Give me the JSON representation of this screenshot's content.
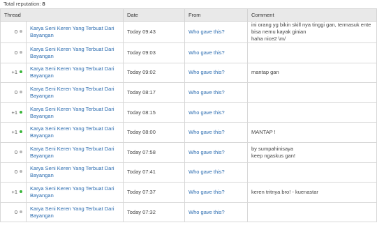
{
  "summary": {
    "label": "Total reputation:",
    "value": "8"
  },
  "columns": {
    "thread": "Thread",
    "date": "Date",
    "from": "From",
    "comment": "Comment"
  },
  "rows": [
    {
      "points": "0",
      "kind": "neutral",
      "thread": "Karya Seni Keren Yang Terbuat Dari Bayangan",
      "date": "Today 09:43",
      "from": "Who gave this?",
      "comment": "ini orang yg bikin skill nya tinggi gan, termasuk ente bisa nemu kayak ginian\nhaha nice2 \\m/"
    },
    {
      "points": "0",
      "kind": "neutral",
      "thread": "Karya Seni Keren Yang Terbuat Dari Bayangan",
      "date": "Today 09:03",
      "from": "Who gave this?",
      "comment": ""
    },
    {
      "points": "+1",
      "kind": "positive",
      "thread": "Karya Seni Keren Yang Terbuat Dari Bayangan",
      "date": "Today 09:02",
      "from": "Who gave this?",
      "comment": "mantap gan"
    },
    {
      "points": "0",
      "kind": "neutral",
      "thread": "Karya Seni Keren Yang Terbuat Dari Bayangan",
      "date": "Today 08:17",
      "from": "Who gave this?",
      "comment": ""
    },
    {
      "points": "+1",
      "kind": "positive",
      "thread": "Karya Seni Keren Yang Terbuat Dari Bayangan",
      "date": "Today 08:15",
      "from": "Who gave this?",
      "comment": ""
    },
    {
      "points": "+1",
      "kind": "positive",
      "thread": "Karya Seni Keren Yang Terbuat Dari Bayangan",
      "date": "Today 08:00",
      "from": "Who gave this?",
      "comment": "MANTAP !"
    },
    {
      "points": "0",
      "kind": "neutral",
      "thread": "Karya Seni Keren Yang Terbuat Dari Bayangan",
      "date": "Today 07:58",
      "from": "Who gave this?",
      "comment": "by sumpahinisaya\nkeep ngaskus gan!"
    },
    {
      "points": "0",
      "kind": "neutral",
      "thread": "Karya Seni Keren Yang Terbuat Dari Bayangan",
      "date": "Today 07:41",
      "from": "Who gave this?",
      "comment": ""
    },
    {
      "points": "+1",
      "kind": "positive",
      "thread": "Karya Seni Keren Yang Terbuat Dari Bayangan",
      "date": "Today 07:37",
      "from": "Who gave this?",
      "comment": "keren tritnya bro! - kuenastar"
    },
    {
      "points": "0",
      "kind": "neutral",
      "thread": "Karya Seni Keren Yang Terbuat Dari Bayangan",
      "date": "Today 07:32",
      "from": "Who gave this?",
      "comment": ""
    }
  ],
  "colors": {
    "positive": "#3cb63c",
    "neutral": "#b8b8b8",
    "link": "#2b6cb0"
  }
}
